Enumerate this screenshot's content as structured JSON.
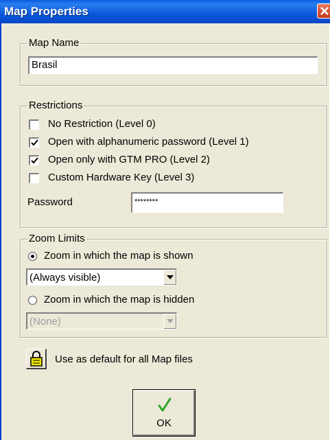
{
  "window": {
    "title": "Map Properties"
  },
  "map_name": {
    "legend": "Map Name",
    "value": "Brasil"
  },
  "restrictions": {
    "legend": "Restrictions",
    "options": [
      {
        "label": "No Restriction (Level 0)",
        "checked": false
      },
      {
        "label": "Open with alphanumeric password  (Level 1)",
        "checked": true
      },
      {
        "label": "Open only with GTM PRO  (Level 2)",
        "checked": true
      },
      {
        "label": "Custom Hardware Key  (Level 3)",
        "checked": false
      }
    ],
    "password_label": "Password",
    "password_value": "********"
  },
  "zoom_limits": {
    "legend": "Zoom Limits",
    "shown_label": "Zoom in which the map is shown",
    "shown_selected": true,
    "shown_value": "(Always visible)",
    "hidden_label": "Zoom in which the map is hidden",
    "hidden_selected": false,
    "hidden_value": "(None)"
  },
  "default_label": "Use as default for all Map files",
  "ok_label": "OK",
  "colors": {
    "titlebar": "#0a58dc",
    "dialog_bg": "#ece9d8",
    "ok_check": "#2fa82f",
    "lock_icon": "#f2e600"
  }
}
